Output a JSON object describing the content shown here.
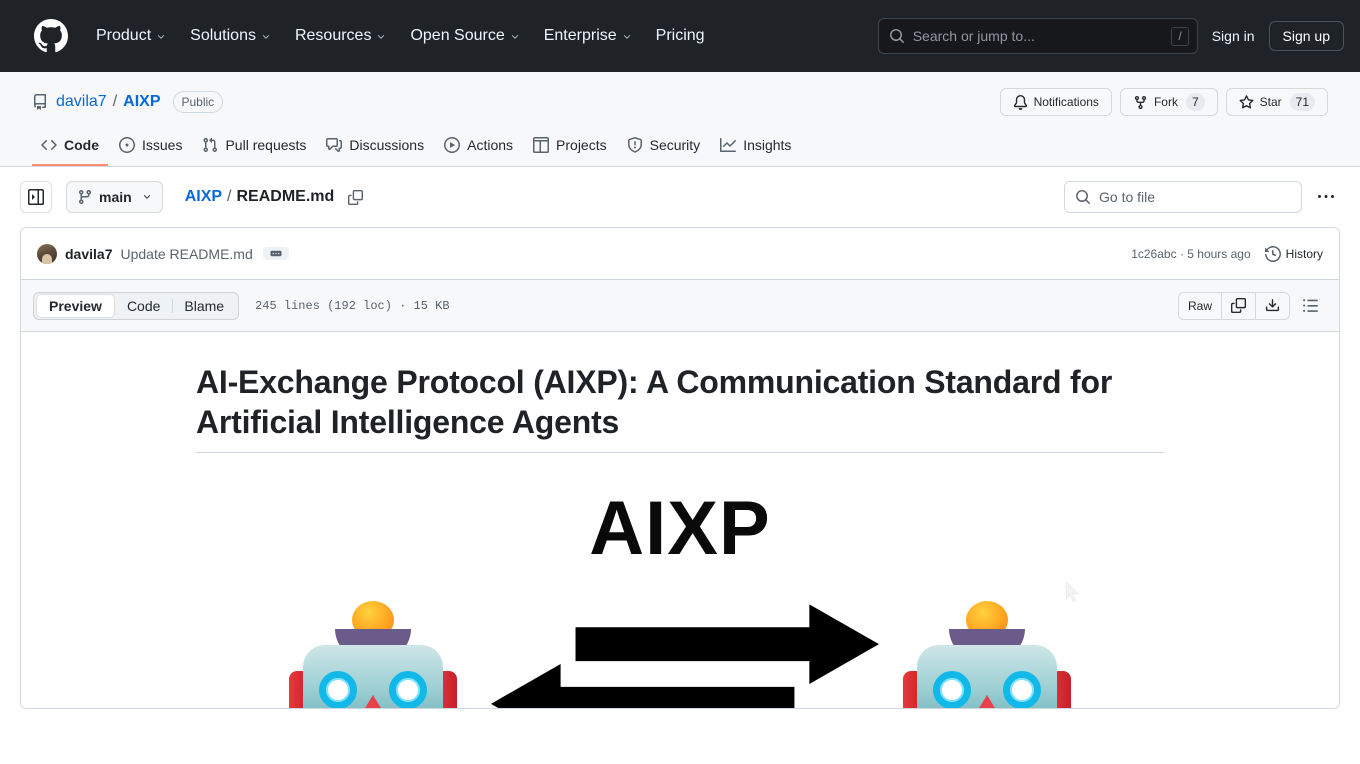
{
  "global_header": {
    "logo_icon": "github-mark-icon",
    "nav": [
      {
        "label": "Product",
        "has_caret": true
      },
      {
        "label": "Solutions",
        "has_caret": true
      },
      {
        "label": "Resources",
        "has_caret": true
      },
      {
        "label": "Open Source",
        "has_caret": true
      },
      {
        "label": "Enterprise",
        "has_caret": true
      },
      {
        "label": "Pricing",
        "has_caret": false
      }
    ],
    "search": {
      "placeholder": "Search or jump to...",
      "icon": "search-icon",
      "shortcut": "/"
    },
    "sign_in": "Sign in",
    "sign_up": "Sign up",
    "background": "#1f2328"
  },
  "repo": {
    "icon": "repo-icon",
    "owner": "davila7",
    "separator": "/",
    "name": "AIXP",
    "visibility": "Public",
    "actions": [
      {
        "label": "Notifications",
        "icon": "bell-icon",
        "count": null
      },
      {
        "label": "Fork",
        "icon": "fork-icon",
        "count": "7"
      },
      {
        "label": "Star",
        "icon": "star-icon",
        "count": "71"
      }
    ],
    "tabs": [
      {
        "label": "Code",
        "icon": "code-icon",
        "active": true
      },
      {
        "label": "Issues",
        "icon": "issue-opened-icon",
        "active": false
      },
      {
        "label": "Pull requests",
        "icon": "git-pull-request-icon",
        "active": false
      },
      {
        "label": "Discussions",
        "icon": "comment-discussion-icon",
        "active": false
      },
      {
        "label": "Actions",
        "icon": "play-icon",
        "active": false
      },
      {
        "label": "Projects",
        "icon": "table-icon",
        "active": false
      },
      {
        "label": "Security",
        "icon": "shield-icon",
        "active": false
      },
      {
        "label": "Insights",
        "icon": "graph-icon",
        "active": false
      }
    ],
    "active_tab_underline": "#fd8c73"
  },
  "file_nav": {
    "sidebar_toggle_icon": "sidebar-expand-icon",
    "branch": {
      "name": "main",
      "icon": "git-branch-icon",
      "caret": "chevron-down-icon"
    },
    "breadcrumb": {
      "root": "AIXP",
      "separator": "/",
      "current": "README.md"
    },
    "copy_path_icon": "copy-icon",
    "go_to_file": {
      "placeholder": "Go to file",
      "icon": "search-icon"
    },
    "more_options_icon": "kebab-horizontal-icon"
  },
  "commit": {
    "avatar": "avatar",
    "author": "davila7",
    "message": "Update README.md",
    "expand_icon": "ellipsis-icon",
    "sha": "1c26abc",
    "dot": "·",
    "time": "5 hours ago",
    "history_label": "History",
    "history_icon": "history-icon"
  },
  "file_toolbar": {
    "views": [
      {
        "label": "Preview",
        "selected": true
      },
      {
        "label": "Code",
        "selected": false
      },
      {
        "label": "Blame",
        "selected": false
      }
    ],
    "stats": "245 lines (192 loc) · 15 KB",
    "raw_label": "Raw",
    "copy_icon": "copy-icon",
    "download_icon": "download-icon",
    "outline_icon": "list-unordered-icon"
  },
  "readme": {
    "heading": "AI-Exchange Protocol (AIXP): A Communication Standard for Artificial Intelligence Agents",
    "logo_text": "AIXP",
    "left_robot_icon": "robot-emoji",
    "right_robot_icon": "robot-emoji",
    "exchange_arrows_icon": "left-right-arrows-icon"
  },
  "cursor": {
    "icon": "mouse-pointer-icon"
  }
}
